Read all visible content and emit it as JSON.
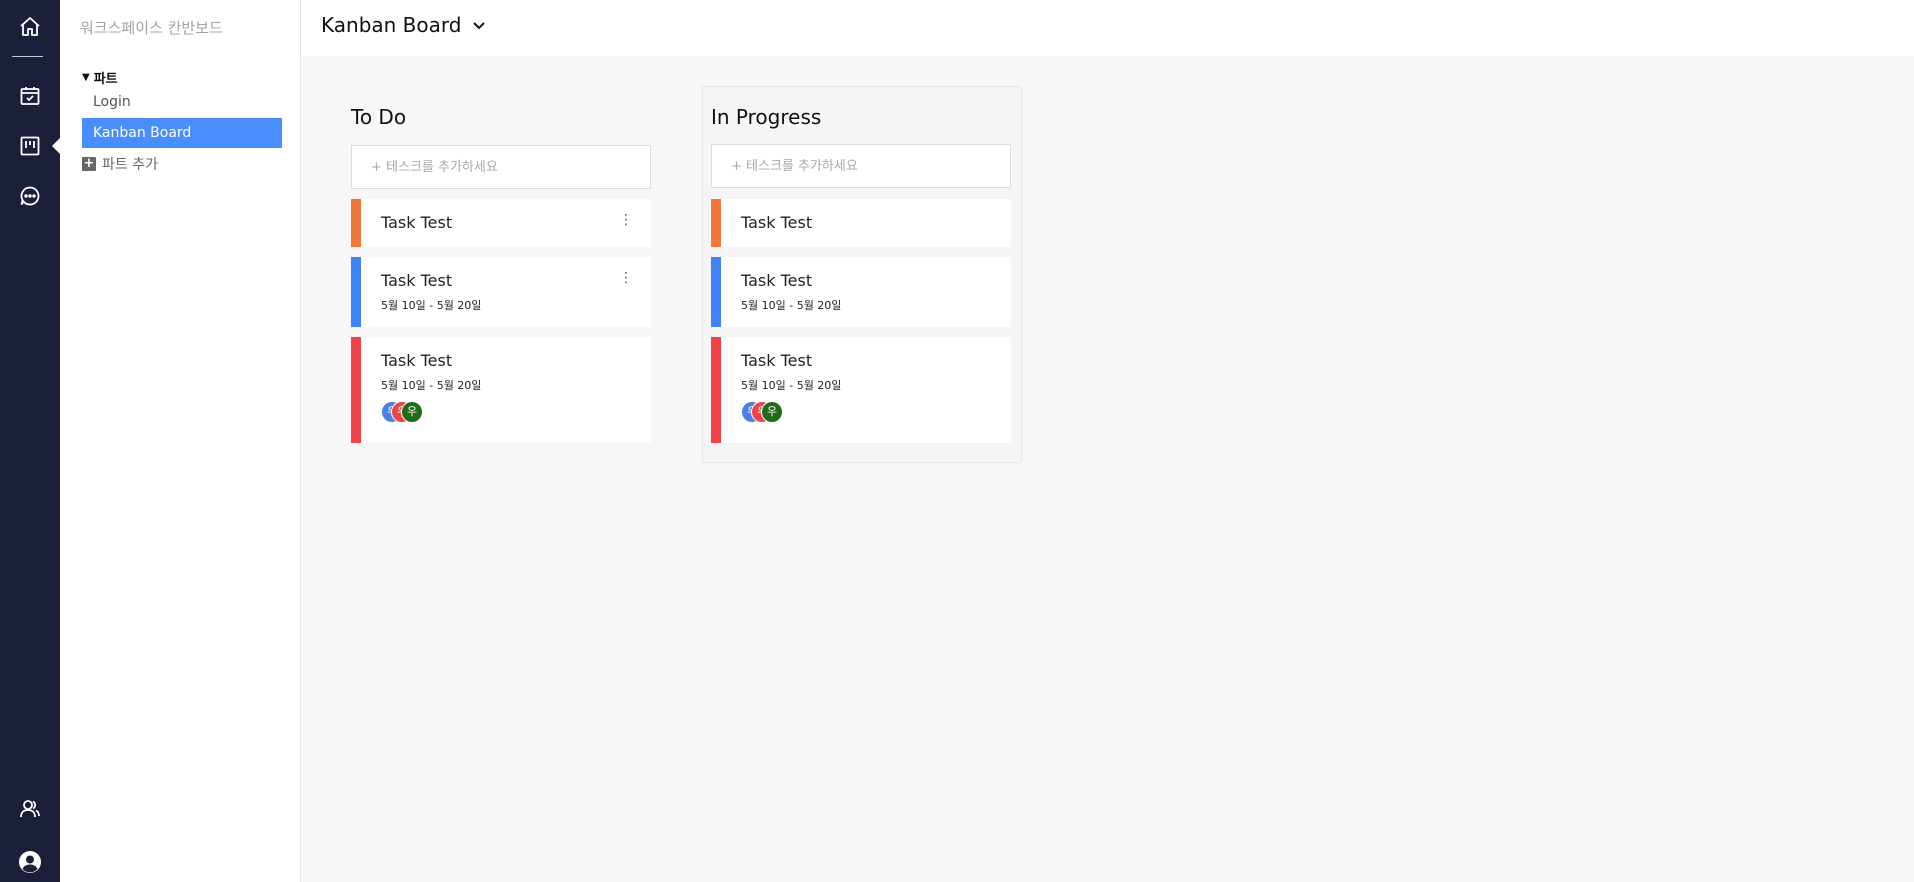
{
  "rail": {
    "icons": [
      "home-icon",
      "calendar-check-icon",
      "kanban-icon",
      "chat-bubble-icon",
      "users-icon",
      "account-icon"
    ]
  },
  "sidebar": {
    "workspace_title": "워크스페이스 칸반보드",
    "section_label": "파트",
    "items": [
      {
        "label": "Login"
      },
      {
        "label": "Kanban Board"
      }
    ],
    "add_part_label": "파트 추가"
  },
  "header": {
    "board_title": "Kanban Board"
  },
  "columns": [
    {
      "title": "To Do",
      "add_placeholder": "+ 테스크를 추가하세요",
      "cards": [
        {
          "title": "Task Test",
          "color": "#f2773a"
        },
        {
          "title": "Task Test",
          "date": "5월 10일 - 5월 20일",
          "color": "#3c83f6"
        },
        {
          "title": "Task Test",
          "date": "5월 10일 - 5월 20일",
          "color": "#f04448",
          "avatars": [
            "우",
            "우",
            "우"
          ]
        }
      ]
    },
    {
      "title": "In Progress",
      "add_placeholder": "+ 테스크를 추가하세요",
      "cards": [
        {
          "title": "Task Test",
          "color": "#f2773a"
        },
        {
          "title": "Task Test",
          "date": "5월 10일 - 5월 20일",
          "color": "#3c83f6"
        },
        {
          "title": "Task Test",
          "date": "5월 10일 - 5월 20일",
          "color": "#f04448",
          "avatars": [
            "우",
            "우",
            "우"
          ]
        }
      ]
    }
  ],
  "colors": {
    "rail_bg": "#1c1f3a",
    "accent": "#4a8dff",
    "avatar_blue": "#4a7fe8",
    "avatar_red": "#f04448",
    "avatar_green": "#1f6b1a"
  }
}
